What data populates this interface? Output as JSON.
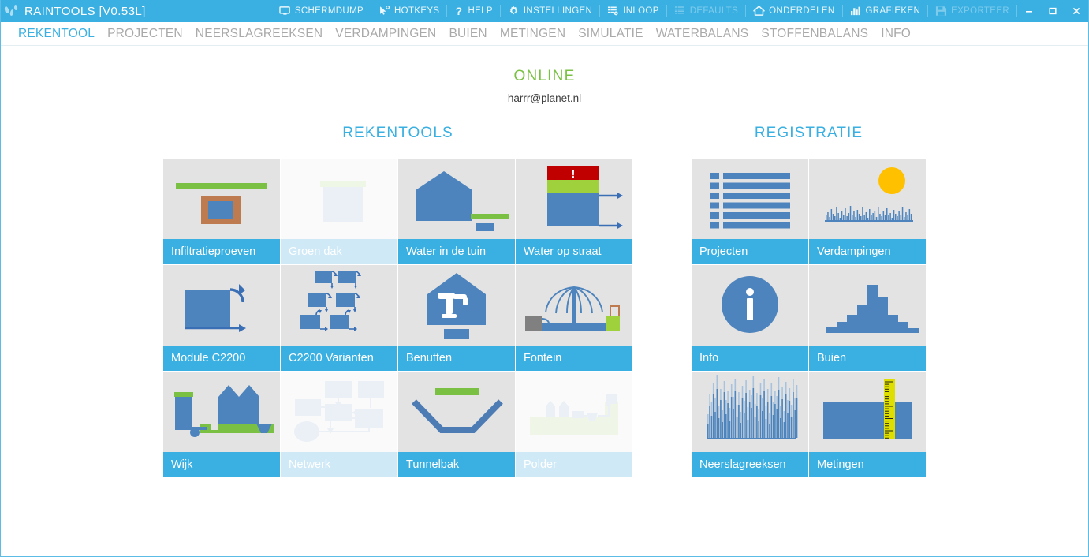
{
  "window": {
    "title": "RAINTOOLS [V0.53L]",
    "logo_icon": "raindrops-icon",
    "controls": {
      "minimize": "minimize-icon",
      "maximize": "maximize-icon",
      "close": "close-icon"
    },
    "accent_color": "#3ab0e2",
    "accent_disabled_color": "#7ecbec",
    "green_color": "#7ac143"
  },
  "toolbar": [
    {
      "label": "SCHERMDUMP",
      "icon": "monitor-icon",
      "disabled": false
    },
    {
      "label": "HOTKEYS",
      "icon": "cursor-icon",
      "disabled": false
    },
    {
      "label": "HELP",
      "icon": "question-icon",
      "disabled": false
    },
    {
      "label": "INSTELLINGEN",
      "icon": "gear-icon",
      "disabled": false
    },
    {
      "label": "INLOOP",
      "icon": "list-gear-icon",
      "disabled": false
    },
    {
      "label": "DEFAULTS",
      "icon": "grid-icon",
      "disabled": true
    },
    {
      "label": "ONDERDELEN",
      "icon": "home-icon",
      "disabled": false
    },
    {
      "label": "GRAFIEKEN",
      "icon": "bar-chart-icon",
      "disabled": false
    },
    {
      "label": "EXPORTEER",
      "icon": "save-icon",
      "disabled": true
    }
  ],
  "menu": [
    {
      "label": "REKENTOOL",
      "active": true
    },
    {
      "label": "PROJECTEN",
      "active": false
    },
    {
      "label": "NEERSLAGREEKSEN",
      "active": false
    },
    {
      "label": "VERDAMPINGEN",
      "active": false
    },
    {
      "label": "BUIEN",
      "active": false
    },
    {
      "label": "METINGEN",
      "active": false
    },
    {
      "label": "SIMULATIE",
      "active": false
    },
    {
      "label": "WATERBALANS",
      "active": false
    },
    {
      "label": "STOFFENBALANS",
      "active": false
    },
    {
      "label": "INFO",
      "active": false
    }
  ],
  "status": {
    "online_label": "ONLINE",
    "email": "harrr@planet.nl"
  },
  "sections": {
    "rekentools": {
      "title": "REKENTOOLS",
      "tiles": [
        {
          "label": "Infiltratieproeven",
          "art": "infiltratieproeven",
          "disabled": false
        },
        {
          "label": "Groen dak",
          "art": "groendak",
          "disabled": true
        },
        {
          "label": "Water in de tuin",
          "art": "watertuin",
          "disabled": false
        },
        {
          "label": "Water op straat",
          "art": "waterstraat",
          "disabled": false
        },
        {
          "label": "Module C2200",
          "art": "modulec2200",
          "disabled": false
        },
        {
          "label": "C2200 Varianten",
          "art": "c2200varianten",
          "disabled": false
        },
        {
          "label": "Benutten",
          "art": "benutten",
          "disabled": false
        },
        {
          "label": "Fontein",
          "art": "fontein",
          "disabled": false
        },
        {
          "label": "Wijk",
          "art": "wijk",
          "disabled": false
        },
        {
          "label": "Netwerk",
          "art": "netwerk",
          "disabled": true
        },
        {
          "label": "Tunnelbak",
          "art": "tunnelbak",
          "disabled": false
        },
        {
          "label": "Polder",
          "art": "polder",
          "disabled": true
        }
      ]
    },
    "registratie": {
      "title": "REGISTRATIE",
      "tiles": [
        {
          "label": "Projecten",
          "art": "projecten",
          "disabled": false
        },
        {
          "label": "Verdampingen",
          "art": "verdampingen",
          "disabled": false
        },
        {
          "label": "Info",
          "art": "info",
          "disabled": false
        },
        {
          "label": "Buien",
          "art": "buien",
          "disabled": false
        },
        {
          "label": "Neerslagreeksen",
          "art": "neerslagreeksen",
          "disabled": false
        },
        {
          "label": "Metingen",
          "art": "metingen",
          "disabled": false
        }
      ]
    }
  }
}
